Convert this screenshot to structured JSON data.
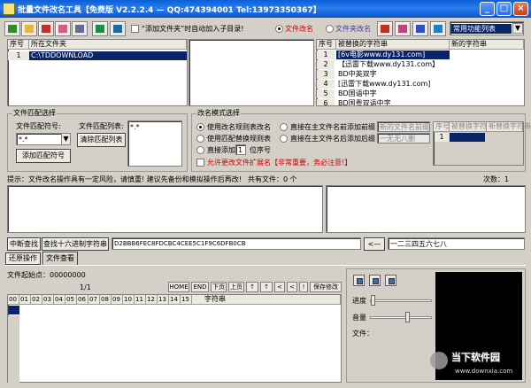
{
  "window": {
    "title": "批量文件改名工具【免费版 V2.2.2.4 — QQ:474394001 Tel:13973350367】",
    "minimize": "_",
    "restore": "□",
    "close": "×"
  },
  "toolbar": {
    "add_folder_option": "“添加文件夹”时自动加入子目录!",
    "file_rename": "文件改名",
    "folder_rename": "文件夹改名",
    "combo_value": "常用功能列表"
  },
  "folders": {
    "col_seq": "序号",
    "col_folder": "所在文件夹",
    "rows": [
      {
        "seq": "1",
        "folder": "C:\\TDDOWNLOAD"
      }
    ]
  },
  "strings": {
    "col_seq": "序号",
    "col_old": "被替换的字符串",
    "col_new": "新的字符串",
    "rows": [
      {
        "seq": "1",
        "old": "[6v电影www.dy131.com]"
      },
      {
        "seq": "2",
        "old": "【迅雷下载www.dy131.com】"
      },
      {
        "seq": "3",
        "old": "BD中英双字"
      },
      {
        "seq": "4",
        "old": "[迅雷下载www.dy131.com]"
      },
      {
        "seq": "5",
        "old": "BD国语中字"
      },
      {
        "seq": "6",
        "old": "BD国粤双语中字"
      }
    ]
  },
  "match": {
    "group_title": "文件匹配选择",
    "symbol_label": "文件匹配符号:",
    "symbol_value": "*.*",
    "list_label": "文件匹配列表:",
    "list_value": "*.*",
    "add_button": "添加匹配符号",
    "clear_button": "清除匹配列表"
  },
  "mode": {
    "group_title": "改名模式选择",
    "opt_list": "使用改名规则表改名",
    "opt_replace": "使用匹配替换规则表",
    "opt_add": "直接添加",
    "seq_value": "1",
    "seq_label": "位序号",
    "opt_prefix": "直接在主文件名前添加前缀",
    "opt_suffix": "直接在主文件名后添加后缀",
    "prefix_placeholder": "新的文件名前缀",
    "suffix_placeholder": "一无无八删",
    "allow_ext": "允许更改文件扩展名【非常重要，务必注意!】",
    "mini_headers": [
      "序号",
      "被替换字符串",
      "新替换字符串"
    ],
    "mini_row_seq": "1"
  },
  "status": {
    "tip": "提示：文件改名操作具有一定风险，请慎重! 建议先备份和模拟操作后再改!",
    "total_files": "共有文件：0 个",
    "count": "次数：1"
  },
  "search": {
    "stop_button": "中断查找",
    "hex_button": "查找十六进制字符串",
    "hex_value": "D2BBB6FEC8FDCBC4CEE5C1F9C6DFB0CB",
    "convert_button": "<—",
    "text_value": "一二三四五六七八"
  },
  "tabs": {
    "restore": "还原操作",
    "view": "文件查看"
  },
  "viewer": {
    "start_label": "文件起始点：00000000",
    "page": "1/1",
    "buttons": [
      "HOME",
      "END",
      "下页",
      "上页",
      "↑",
      "↑",
      "<",
      "<",
      "!",
      "保存修改"
    ],
    "hex_headers": [
      "00",
      "01",
      "02",
      "03",
      "04",
      "05",
      "06",
      "07",
      "08",
      "09",
      "10",
      "11",
      "12",
      "13",
      "14",
      "15",
      "字符串"
    ]
  },
  "player": {
    "progress_label": "进度",
    "volume_label": "音量",
    "file_label": "文件："
  },
  "watermark": {
    "text": "当下软件园",
    "url": "www.downxia.com"
  },
  "colors": {
    "title_bar": "#0a5fd8",
    "selection": "#0a246a",
    "accent_red": "#d00000"
  }
}
